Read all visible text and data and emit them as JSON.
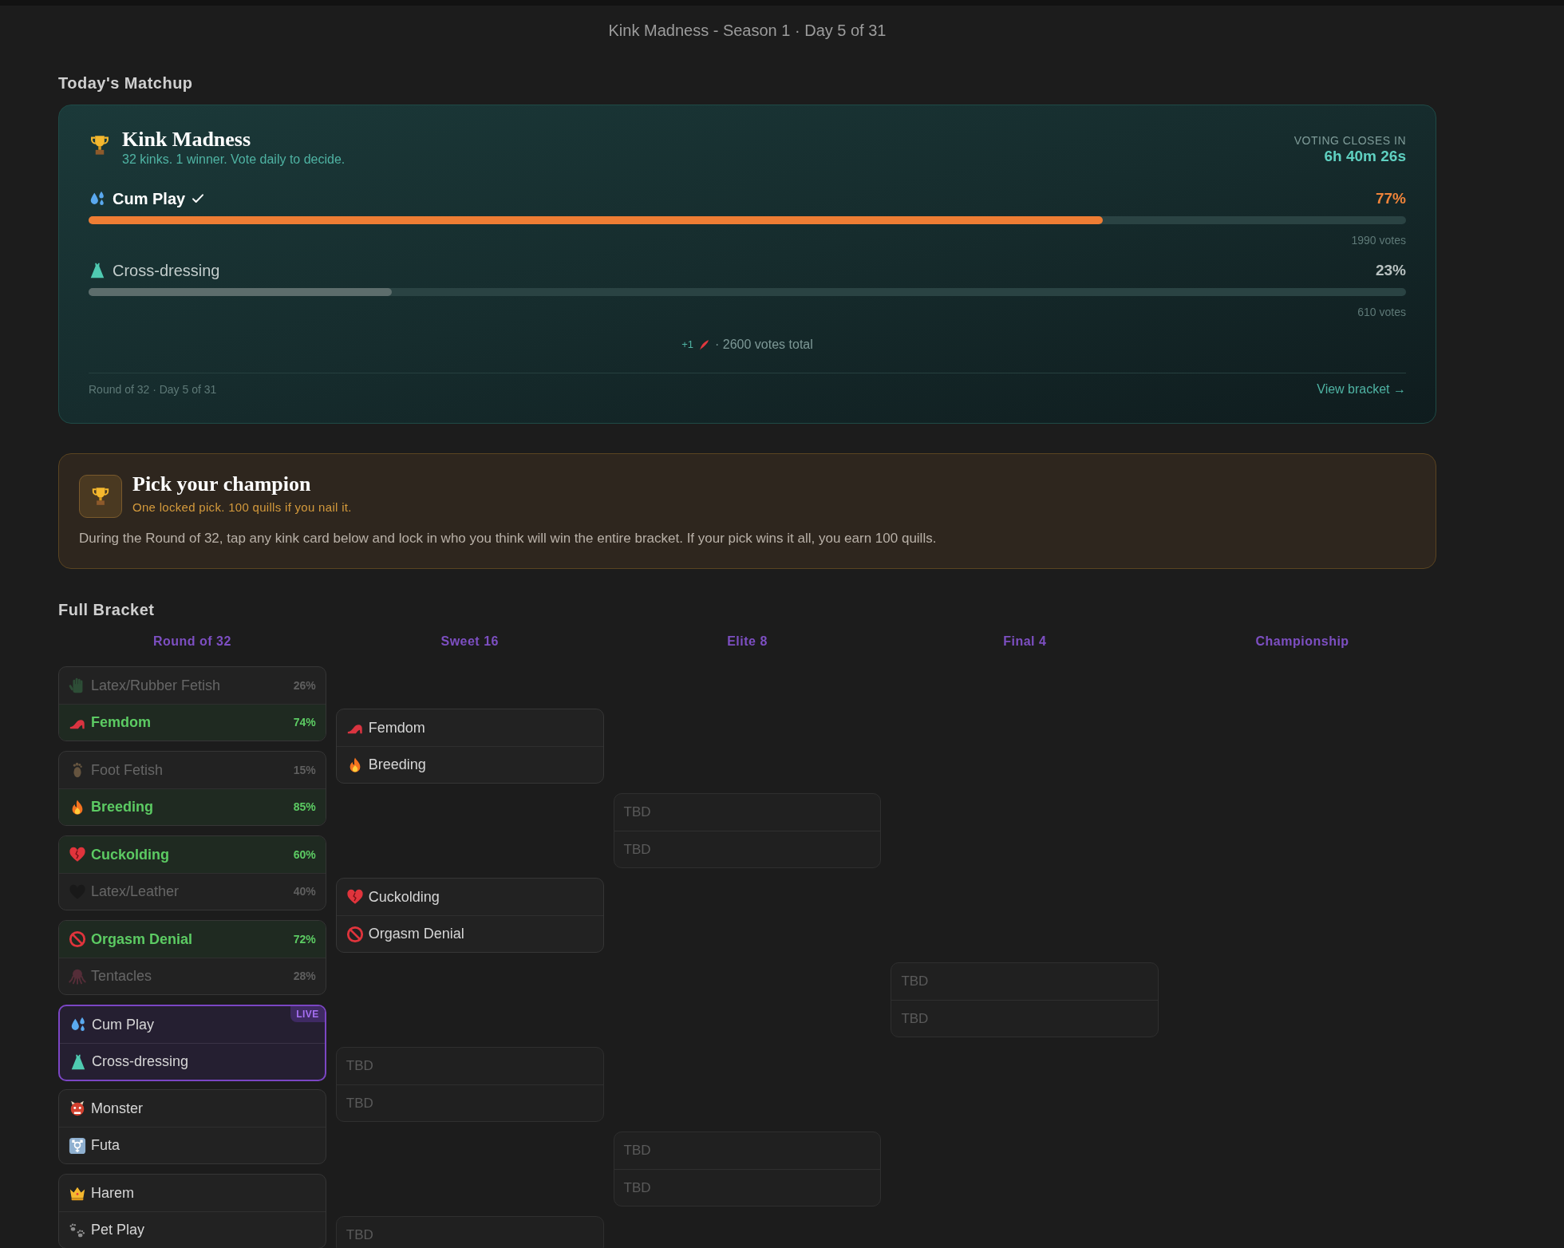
{
  "header": {
    "title": "Kink Madness - Season 1 · Day 5 of 31"
  },
  "matchup": {
    "heading": "Today's Matchup",
    "title": "Kink Madness",
    "subtitle": "32 kinks. 1 winner. Vote daily to decide.",
    "countdown_label": "VOTING CLOSES IN",
    "countdown": "6h 40m 26s",
    "options": [
      {
        "name": "Cum Play",
        "voted": true,
        "percent": "77%",
        "level": 0.77,
        "votes": "1990 votes"
      },
      {
        "name": "Cross-dressing",
        "voted": false,
        "percent": "23%",
        "level": 0.23,
        "votes": "610 votes"
      }
    ],
    "bonus": "+1",
    "total": "· 2600 votes total",
    "footer": "Round of 32 · Day 5 of 31",
    "link": "View bracket →"
  },
  "champion": {
    "title": "Pick your champion",
    "subtitle": "One locked pick. 100 quills if you nail it.",
    "description": "During the Round of 32, tap any kink card below and lock in who you think will win the entire bracket. If your pick wins it all, you earn 100 quills."
  },
  "bracket": {
    "heading": "Full Bracket",
    "rounds": [
      {
        "name": "Round of 32",
        "matches": [
          {
            "live": false,
            "entrants": [
              {
                "name": "Latex/Rubber Fetish",
                "kind": "loser",
                "share": "26%"
              },
              {
                "name": "Femdom",
                "kind": "winner",
                "share": "74%"
              }
            ]
          },
          {
            "live": false,
            "entrants": [
              {
                "name": "Foot Fetish",
                "kind": "loser",
                "share": "15%"
              },
              {
                "name": "Breeding",
                "kind": "winner",
                "share": "85%"
              }
            ]
          },
          {
            "live": false,
            "entrants": [
              {
                "name": "Cuckolding",
                "kind": "winner",
                "share": "60%"
              },
              {
                "name": "Latex/Leather",
                "kind": "loser",
                "share": "40%"
              }
            ]
          },
          {
            "live": false,
            "entrants": [
              {
                "name": "Orgasm Denial",
                "kind": "winner",
                "share": "72%"
              },
              {
                "name": "Tentacles",
                "kind": "loser",
                "share": "28%"
              }
            ]
          },
          {
            "live": true,
            "badge": "LIVE",
            "entrants": [
              {
                "name": "Cum Play",
                "kind": "open"
              },
              {
                "name": "Cross-dressing",
                "kind": "open"
              }
            ]
          },
          {
            "live": false,
            "entrants": [
              {
                "name": "Monster",
                "kind": "open"
              },
              {
                "name": "Futa",
                "kind": "open"
              }
            ]
          },
          {
            "live": false,
            "entrants": [
              {
                "name": "Harem",
                "kind": "open"
              },
              {
                "name": "Pet Play",
                "kind": "open"
              }
            ]
          }
        ]
      },
      {
        "name": "Sweet 16",
        "matches": [
          {
            "live": false,
            "entrants": [
              {
                "name": "Femdom",
                "kind": "open"
              },
              {
                "name": "Breeding",
                "kind": "open"
              }
            ]
          },
          {
            "live": false,
            "entrants": [
              {
                "name": "Cuckolding",
                "kind": "open"
              },
              {
                "name": "Orgasm Denial",
                "kind": "open"
              }
            ]
          },
          {
            "live": false,
            "entrants": [
              {
                "name": "TBD",
                "kind": "placeholder"
              },
              {
                "name": "TBD",
                "kind": "placeholder"
              }
            ]
          },
          {
            "live": false,
            "entrants": [
              {
                "name": "TBD",
                "kind": "placeholder"
              }
            ]
          }
        ]
      },
      {
        "name": "Elite 8",
        "matches": [
          {
            "live": false,
            "entrants": [
              {
                "name": "TBD",
                "kind": "placeholder"
              },
              {
                "name": "TBD",
                "kind": "placeholder"
              }
            ]
          },
          {
            "live": false,
            "entrants": [
              {
                "name": "TBD",
                "kind": "placeholder"
              },
              {
                "name": "TBD",
                "kind": "placeholder"
              }
            ]
          }
        ]
      },
      {
        "name": "Final 4",
        "matches": [
          {
            "live": false,
            "entrants": [
              {
                "name": "TBD",
                "kind": "placeholder"
              },
              {
                "name": "TBD",
                "kind": "placeholder"
              }
            ]
          }
        ]
      },
      {
        "name": "Championship"
      }
    ]
  }
}
